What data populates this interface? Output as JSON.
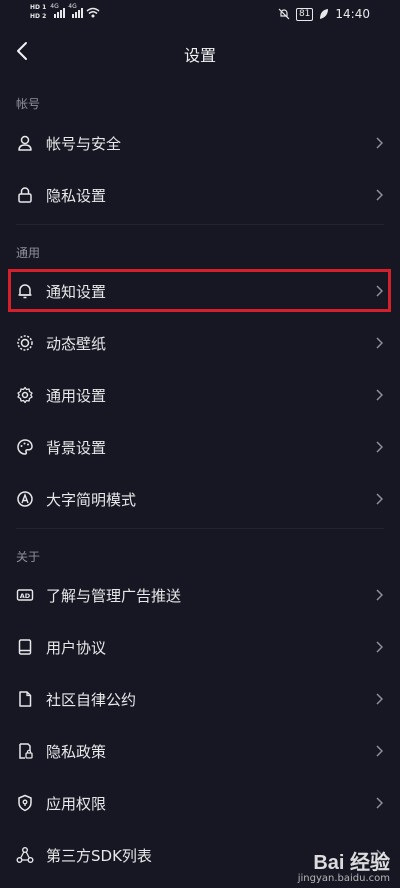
{
  "status": {
    "hd1": "HD 1",
    "hd2": "HD 2",
    "net1": "4G",
    "net2": "4G",
    "battery": "81",
    "time": "14:40"
  },
  "header": {
    "title": "设置"
  },
  "sections": {
    "account": {
      "label": "帐号",
      "items": [
        {
          "label": "帐号与安全",
          "icon": "user-icon"
        },
        {
          "label": "隐私设置",
          "icon": "lock-icon"
        }
      ]
    },
    "general": {
      "label": "通用",
      "items": [
        {
          "label": "通知设置",
          "icon": "bell-icon"
        },
        {
          "label": "动态壁纸",
          "icon": "wallpaper-icon"
        },
        {
          "label": "通用设置",
          "icon": "gear-icon"
        },
        {
          "label": "背景设置",
          "icon": "palette-icon"
        },
        {
          "label": "大字简明模式",
          "icon": "font-size-icon"
        }
      ]
    },
    "about": {
      "label": "关于",
      "items": [
        {
          "label": "了解与管理广告推送",
          "icon": "ad-icon"
        },
        {
          "label": "用户协议",
          "icon": "book-icon"
        },
        {
          "label": "社区自律公约",
          "icon": "document-icon"
        },
        {
          "label": "隐私政策",
          "icon": "privacy-policy-icon"
        },
        {
          "label": "应用权限",
          "icon": "shield-icon"
        },
        {
          "label": "第三方SDK列表",
          "icon": "network-icon"
        }
      ]
    }
  },
  "watermark": {
    "main": "Bai 经验",
    "sub": "jingyan.baidu.com"
  },
  "colors": {
    "background": "#161722",
    "highlight": "#d3202a",
    "text": "#e8e8ea",
    "muted": "#8e8f99"
  }
}
